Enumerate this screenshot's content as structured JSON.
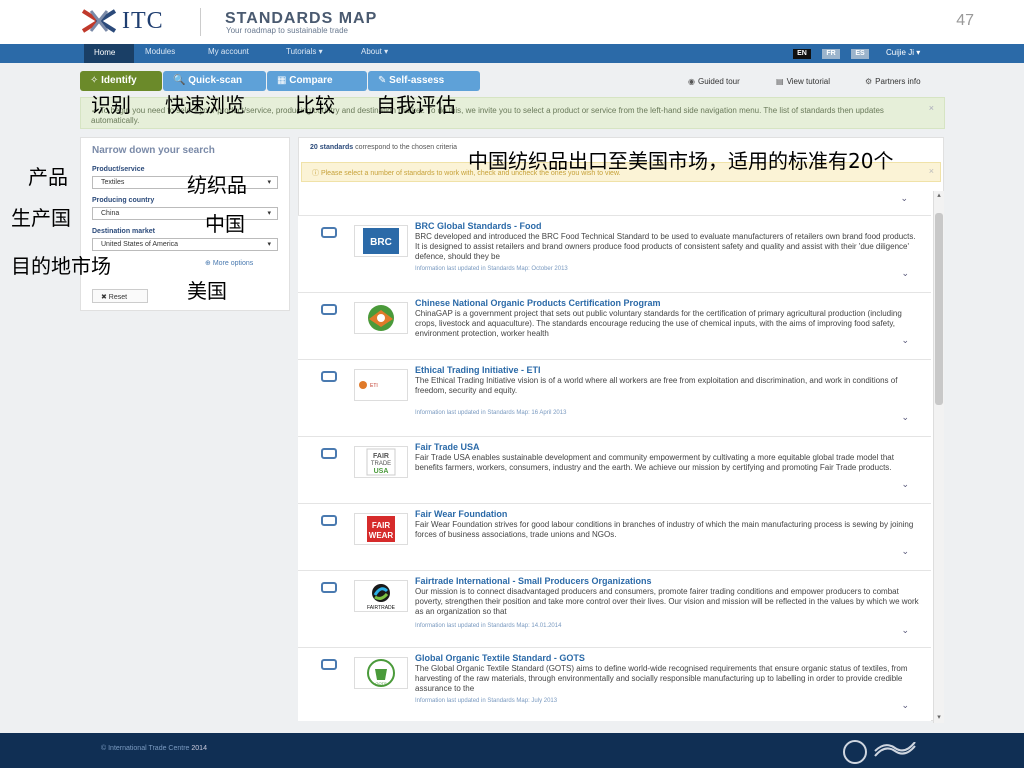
{
  "header": {
    "logo_text": "ITC",
    "title": "STANDARDS MAP",
    "subtitle": "Your roadmap to sustainable trade",
    "page_number": "47"
  },
  "nav": {
    "items": [
      "Home",
      "Modules",
      "My account",
      "Tutorials ▾",
      "About ▾"
    ],
    "languages": [
      "EN",
      "FR",
      "ES"
    ],
    "user": "Cuijie Ji ▾"
  },
  "modes": {
    "tabs": [
      "✧ Identify",
      "🔍 Quick-scan",
      "▦ Compare",
      "✎ Self-assess"
    ],
    "links": [
      "Guided tour",
      "View tutorial",
      "Partners info"
    ]
  },
  "info_band": {
    "text": "✓ To begin you need to select your product/service, producing country and destination market. To do this, we invite you to select a product or service from the left-hand side navigation menu. The list of standards then updates automatically."
  },
  "sidebar": {
    "title": "Narrow down your search",
    "product_label": "Product/service",
    "product_value": "Textiles",
    "country_label": "Producing country",
    "country_value": "China",
    "market_label": "Destination market",
    "market_value": "United States of America",
    "more_options": "More options",
    "reset": "✖ Reset"
  },
  "results": {
    "count_bold": "20 standards",
    "count_rest": " correspond to the chosen criteria",
    "warning": "Please select a number of standards to work with, check and uncheck the ones you wish to view.",
    "items": [
      {
        "title": "BRC Global Standards - Food",
        "desc": "BRC developed and introduced the BRC Food Technical Standard to be used to evaluate manufacturers of retailers own brand food products. It is designed to assist retailers and brand owners produce food products of consistent safety and quality and assist with their 'due diligence' defence, should they be",
        "date": "Information last updated in Standards Map: October 2013",
        "logo": "BRC"
      },
      {
        "title": "Chinese National Organic Products Certification Program",
        "desc": "ChinaGAP is a government project that sets out public voluntary standards for the certification of primary agricultural production (including crops, livestock and aquaculture). The standards encourage reducing the use of chemical inputs, with the aims of improving food safety, environment protection, worker health",
        "date": "",
        "logo": "organic"
      },
      {
        "title": "Ethical Trading Initiative - ETI",
        "desc": "The Ethical Trading Initiative vision is of a world where all workers are free from exploitation and discrimination, and work in conditions of freedom, security and equity.",
        "date": "Information last updated in Standards Map: 16 April 2013",
        "logo": "ETI"
      },
      {
        "title": "Fair Trade USA",
        "desc": "Fair Trade USA enables sustainable development and community empowerment by cultivating a more equitable global trade model that benefits farmers, workers, consumers, industry and the earth. We achieve our mission by certifying and promoting Fair Trade products.",
        "date": "",
        "logo": "FAIR TRADE USA"
      },
      {
        "title": "Fair Wear Foundation",
        "desc": "Fair Wear Foundation strives for good labour conditions in branches of industry of which the main manufacturing process is sewing by joining forces of business associations, trade unions and NGOs.",
        "date": "",
        "logo": "FAIR WEAR"
      },
      {
        "title": "Fairtrade International - Small Producers Organizations",
        "desc": "Our mission is to connect disadvantaged producers and consumers, promote fairer trading conditions and empower producers to combat poverty, strengthen their position and take more control over their lives. Our vision and mission will be reflected in the values by which we work as an organization so that",
        "date": "Information last updated in Standards Map: 14.01.2014",
        "logo": "FAIRTRADE"
      },
      {
        "title": "Global Organic Textile Standard - GOTS",
        "desc": "The Global Organic Textile Standard (GOTS) aims to define world-wide recognised requirements that ensure organic status of textiles, from harvesting of the raw materials, through environmentally and socially responsible manufacturing up to labelling in order to provide credible assurance to the",
        "date": "Information last updated in Standards Map: July 2013",
        "logo": "GOTS"
      }
    ]
  },
  "footer": {
    "org": "International Trade Centre",
    "year": "2014"
  },
  "annotations": {
    "modes": [
      "识别",
      "快速浏览",
      "比较",
      "自我评估"
    ],
    "product": "产品",
    "product_value": "纺织品",
    "country": "生产国",
    "country_value": "中国",
    "market": "目的地市场",
    "market_value": "美国",
    "summary": "中国纺织品出口至美国市场，适用的标准有20个"
  },
  "colors": {
    "nav_bg": "#2b6aa8",
    "identify_tab": "#6b8a2a",
    "mode_tab": "#5ea1d8",
    "footer_bg": "#102f54",
    "link": "#2b6aa8"
  }
}
